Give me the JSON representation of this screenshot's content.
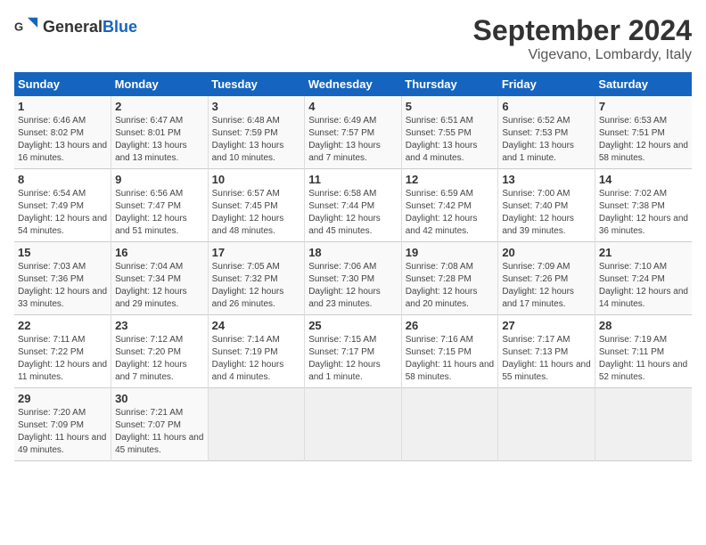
{
  "header": {
    "logo_general": "General",
    "logo_blue": "Blue",
    "month_title": "September 2024",
    "location": "Vigevano, Lombardy, Italy"
  },
  "calendar": {
    "days_of_week": [
      "Sunday",
      "Monday",
      "Tuesday",
      "Wednesday",
      "Thursday",
      "Friday",
      "Saturday"
    ],
    "weeks": [
      [
        {
          "day": "1",
          "sunrise": "6:46 AM",
          "sunset": "8:02 PM",
          "daylight": "13 hours and 16 minutes."
        },
        {
          "day": "2",
          "sunrise": "6:47 AM",
          "sunset": "8:01 PM",
          "daylight": "13 hours and 13 minutes."
        },
        {
          "day": "3",
          "sunrise": "6:48 AM",
          "sunset": "7:59 PM",
          "daylight": "13 hours and 10 minutes."
        },
        {
          "day": "4",
          "sunrise": "6:49 AM",
          "sunset": "7:57 PM",
          "daylight": "13 hours and 7 minutes."
        },
        {
          "day": "5",
          "sunrise": "6:51 AM",
          "sunset": "7:55 PM",
          "daylight": "13 hours and 4 minutes."
        },
        {
          "day": "6",
          "sunrise": "6:52 AM",
          "sunset": "7:53 PM",
          "daylight": "13 hours and 1 minute."
        },
        {
          "day": "7",
          "sunrise": "6:53 AM",
          "sunset": "7:51 PM",
          "daylight": "12 hours and 58 minutes."
        }
      ],
      [
        {
          "day": "8",
          "sunrise": "6:54 AM",
          "sunset": "7:49 PM",
          "daylight": "12 hours and 54 minutes."
        },
        {
          "day": "9",
          "sunrise": "6:56 AM",
          "sunset": "7:47 PM",
          "daylight": "12 hours and 51 minutes."
        },
        {
          "day": "10",
          "sunrise": "6:57 AM",
          "sunset": "7:45 PM",
          "daylight": "12 hours and 48 minutes."
        },
        {
          "day": "11",
          "sunrise": "6:58 AM",
          "sunset": "7:44 PM",
          "daylight": "12 hours and 45 minutes."
        },
        {
          "day": "12",
          "sunrise": "6:59 AM",
          "sunset": "7:42 PM",
          "daylight": "12 hours and 42 minutes."
        },
        {
          "day": "13",
          "sunrise": "7:00 AM",
          "sunset": "7:40 PM",
          "daylight": "12 hours and 39 minutes."
        },
        {
          "day": "14",
          "sunrise": "7:02 AM",
          "sunset": "7:38 PM",
          "daylight": "12 hours and 36 minutes."
        }
      ],
      [
        {
          "day": "15",
          "sunrise": "7:03 AM",
          "sunset": "7:36 PM",
          "daylight": "12 hours and 33 minutes."
        },
        {
          "day": "16",
          "sunrise": "7:04 AM",
          "sunset": "7:34 PM",
          "daylight": "12 hours and 29 minutes."
        },
        {
          "day": "17",
          "sunrise": "7:05 AM",
          "sunset": "7:32 PM",
          "daylight": "12 hours and 26 minutes."
        },
        {
          "day": "18",
          "sunrise": "7:06 AM",
          "sunset": "7:30 PM",
          "daylight": "12 hours and 23 minutes."
        },
        {
          "day": "19",
          "sunrise": "7:08 AM",
          "sunset": "7:28 PM",
          "daylight": "12 hours and 20 minutes."
        },
        {
          "day": "20",
          "sunrise": "7:09 AM",
          "sunset": "7:26 PM",
          "daylight": "12 hours and 17 minutes."
        },
        {
          "day": "21",
          "sunrise": "7:10 AM",
          "sunset": "7:24 PM",
          "daylight": "12 hours and 14 minutes."
        }
      ],
      [
        {
          "day": "22",
          "sunrise": "7:11 AM",
          "sunset": "7:22 PM",
          "daylight": "12 hours and 11 minutes."
        },
        {
          "day": "23",
          "sunrise": "7:12 AM",
          "sunset": "7:20 PM",
          "daylight": "12 hours and 7 minutes."
        },
        {
          "day": "24",
          "sunrise": "7:14 AM",
          "sunset": "7:19 PM",
          "daylight": "12 hours and 4 minutes."
        },
        {
          "day": "25",
          "sunrise": "7:15 AM",
          "sunset": "7:17 PM",
          "daylight": "12 hours and 1 minute."
        },
        {
          "day": "26",
          "sunrise": "7:16 AM",
          "sunset": "7:15 PM",
          "daylight": "11 hours and 58 minutes."
        },
        {
          "day": "27",
          "sunrise": "7:17 AM",
          "sunset": "7:13 PM",
          "daylight": "11 hours and 55 minutes."
        },
        {
          "day": "28",
          "sunrise": "7:19 AM",
          "sunset": "7:11 PM",
          "daylight": "11 hours and 52 minutes."
        }
      ],
      [
        {
          "day": "29",
          "sunrise": "7:20 AM",
          "sunset": "7:09 PM",
          "daylight": "11 hours and 49 minutes."
        },
        {
          "day": "30",
          "sunrise": "7:21 AM",
          "sunset": "7:07 PM",
          "daylight": "11 hours and 45 minutes."
        },
        null,
        null,
        null,
        null,
        null
      ]
    ],
    "labels": {
      "sunrise": "Sunrise:",
      "sunset": "Sunset:",
      "daylight": "Daylight:"
    }
  }
}
